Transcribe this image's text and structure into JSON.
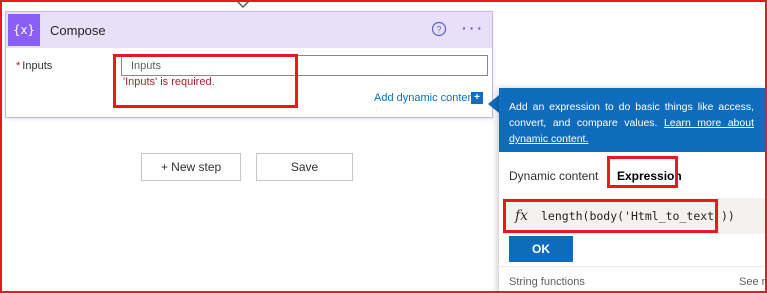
{
  "card": {
    "title": "Compose",
    "icon": "{x}",
    "inputs_label": "Inputs",
    "inputs_required_marker": "*",
    "inputs_placeholder": "Inputs",
    "inputs_value": "",
    "error_text": "'Inputs' is required.",
    "add_dynamic_content": "Add dynamic content",
    "add_dynamic_icon": "+",
    "more_dots": "···"
  },
  "actions": {
    "new_step": "+ New step",
    "save": "Save"
  },
  "panel": {
    "info_text": "Add an expression to do basic things like access, convert, and compare values. ",
    "info_link": "Learn more about dynamic content.",
    "tabs": [
      {
        "label": "Dynamic content",
        "selected": false
      },
      {
        "label": "Expression",
        "selected": true
      }
    ],
    "fx": "fx",
    "expression_value": "length(body('Html_to_text'))",
    "ok_label": "OK",
    "string_functions": "String functions",
    "see_more": "See m"
  },
  "colors": {
    "accent": "#0f6cbd",
    "compose_purple": "#8a5ff5",
    "highlight_red": "#e5191e",
    "error_red": "#a4262c"
  }
}
